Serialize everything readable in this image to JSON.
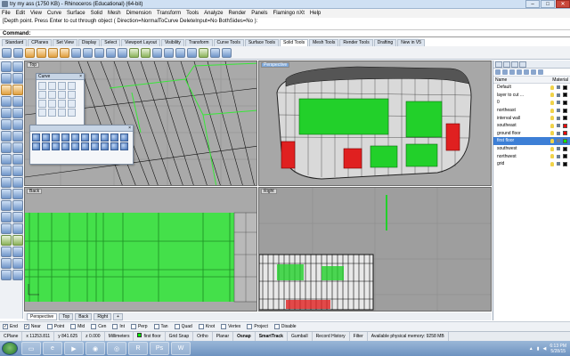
{
  "title": "try my ass (1750 KB) - Rhinoceros (Educational) (64-bit)",
  "window_controls": {
    "minimize": "–",
    "maximize": "□",
    "close": "✕"
  },
  "menu": [
    "File",
    "Edit",
    "View",
    "Curve",
    "Surface",
    "Solid",
    "Mesh",
    "Dimension",
    "Transform",
    "Tools",
    "Analyze",
    "Render",
    "Panels",
    "Flamingo nXt",
    "Help"
  ],
  "command_history": "[Depth point. Press Enter to cut through object ( Direction=NormalToCurve  DeleteInput=No  BothSides=No ):",
  "command_prompt": "Command:",
  "toolbar_tabs": [
    {
      "label": "Standard",
      "active": false
    },
    {
      "label": "CPlanes",
      "active": false
    },
    {
      "label": "Set View",
      "active": false
    },
    {
      "label": "Display",
      "active": false
    },
    {
      "label": "Select",
      "active": false
    },
    {
      "label": "Viewport Layout",
      "active": false
    },
    {
      "label": "Visibility",
      "active": false
    },
    {
      "label": "Transform",
      "active": false
    },
    {
      "label": "Curve Tools",
      "active": false
    },
    {
      "label": "Surface Tools",
      "active": false
    },
    {
      "label": "Solid Tools",
      "active": true
    },
    {
      "label": "Mesh Tools",
      "active": false
    },
    {
      "label": "Render Tools",
      "active": false
    },
    {
      "label": "Drafting",
      "active": false
    },
    {
      "label": "New in V5",
      "active": false
    }
  ],
  "viewports": {
    "top": {
      "label": "Top",
      "active": false
    },
    "perspective": {
      "label": "Perspective",
      "active": true
    },
    "back": {
      "label": "Back",
      "active": false
    },
    "right": {
      "label": "Right",
      "active": false
    }
  },
  "floating_panels": {
    "curve": {
      "title": "Curve",
      "close": "×"
    },
    "solid": {
      "title": "",
      "close": "×"
    }
  },
  "viewport_tabs": [
    {
      "label": "Perspective",
      "active": true
    },
    {
      "label": "Top",
      "active": false
    },
    {
      "label": "Back",
      "active": false
    },
    {
      "label": "Right",
      "active": false
    },
    {
      "label": "+",
      "active": false
    }
  ],
  "osnaps": [
    {
      "label": "End",
      "checked": true
    },
    {
      "label": "Near",
      "checked": true
    },
    {
      "label": "Point",
      "checked": false
    },
    {
      "label": "Mid",
      "checked": false
    },
    {
      "label": "Cen",
      "checked": false
    },
    {
      "label": "Int",
      "checked": false
    },
    {
      "label": "Perp",
      "checked": false
    },
    {
      "label": "Tan",
      "checked": false
    },
    {
      "label": "Quad",
      "checked": false
    },
    {
      "label": "Knot",
      "checked": false
    },
    {
      "label": "Vertex",
      "checked": false
    },
    {
      "label": "Project",
      "checked": false
    },
    {
      "label": "Disable",
      "checked": false
    }
  ],
  "status": {
    "cplane": "CPlane",
    "x": "x 11253.811",
    "y": "y 841.625",
    "z": "z 0.000",
    "units": "Millimeters",
    "layer": "first floor",
    "grid_snap": "Grid Snap",
    "ortho": "Ortho",
    "planar": "Planar",
    "osnap": "Osnap",
    "smarttrack": "SmartTrack",
    "gumball": "Gumball",
    "record_history": "Record History",
    "filter": "Filter",
    "memory": "Available physical memory: 9258 MB"
  },
  "layers": {
    "header_name": "Name",
    "header_material": "Material",
    "rows": [
      {
        "name": "Default",
        "color": "#000000",
        "selected": false
      },
      {
        "name": "layer to cut ...",
        "color": "#000000",
        "selected": false
      },
      {
        "name": "0",
        "color": "#000000",
        "selected": false
      },
      {
        "name": "northeast",
        "color": "#000000",
        "selected": false
      },
      {
        "name": "interval wall",
        "color": "#000000",
        "selected": false
      },
      {
        "name": "southeast",
        "color": "#ff0000",
        "selected": false
      },
      {
        "name": "ground floor",
        "color": "#ff0000",
        "selected": false
      },
      {
        "name": "first floor",
        "color": "#00ff00",
        "selected": true
      },
      {
        "name": "southwest",
        "color": "#000000",
        "selected": false
      },
      {
        "name": "northwest",
        "color": "#000000",
        "selected": false
      },
      {
        "name": "grid",
        "color": "#000000",
        "selected": false
      }
    ]
  },
  "taskbar": {
    "apps": [
      "start",
      "explorer",
      "ie",
      "media",
      "firefox",
      "chrome",
      "rhino",
      "photoshop",
      "word"
    ],
    "time": "6:13 PM",
    "date": "5/28/15"
  }
}
